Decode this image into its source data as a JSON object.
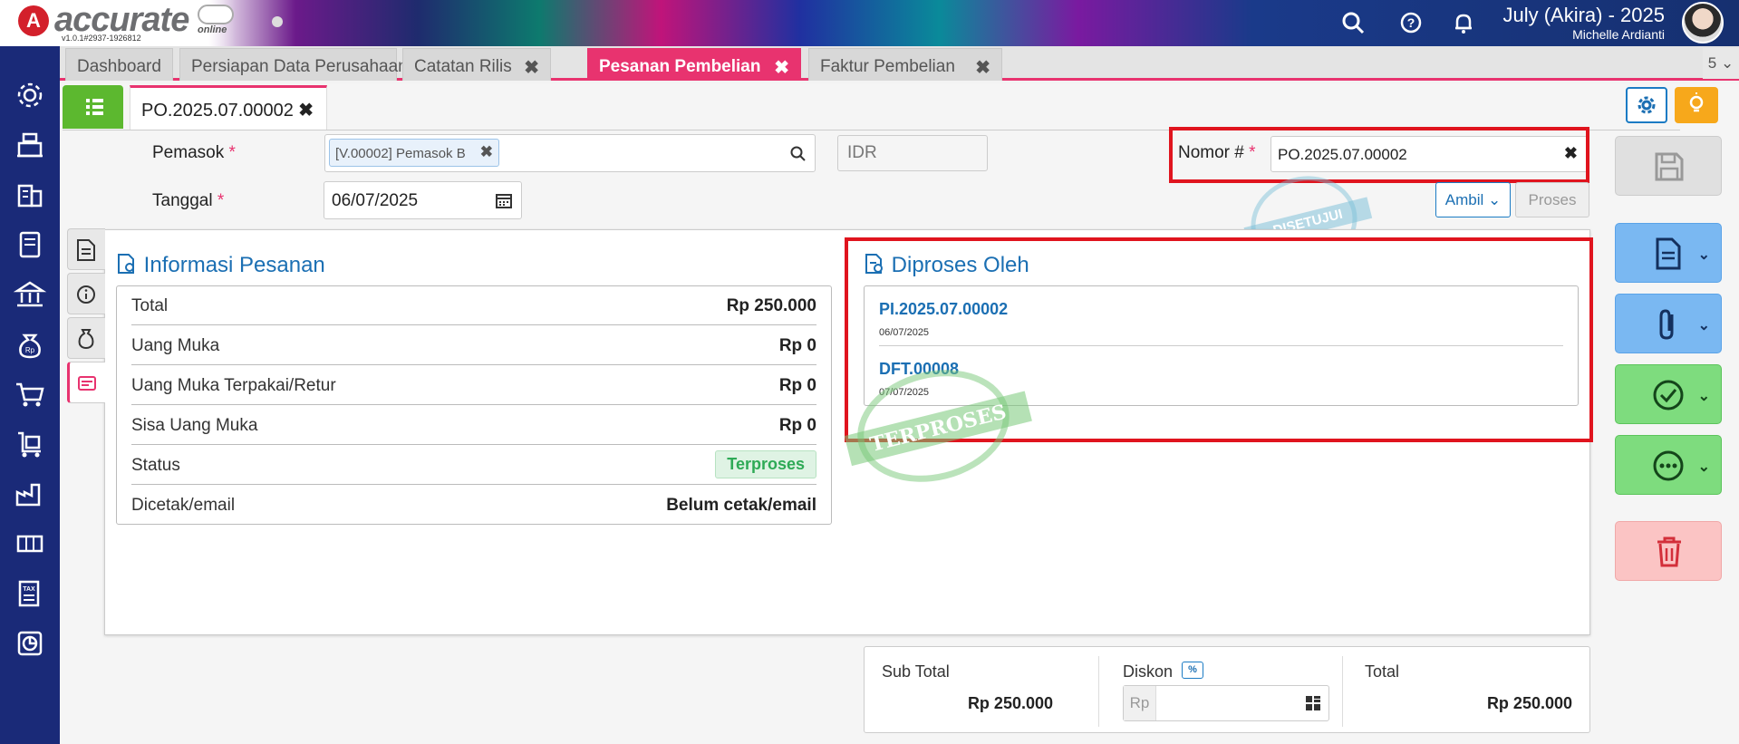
{
  "app": {
    "brand": "accurate",
    "brand_sub": "online",
    "version": "v1.0.1#2937-1926812",
    "period": "July (Akira) - 2025",
    "user_name": "Michelle Ardianti"
  },
  "topbar_icons": [
    "search-icon",
    "help-icon",
    "bell-icon"
  ],
  "sidebar": {
    "items": [
      {
        "icon": "settings-icon"
      },
      {
        "icon": "cash-register-icon"
      },
      {
        "icon": "building-icon"
      },
      {
        "icon": "ledger-book-icon"
      },
      {
        "icon": "bank-icon"
      },
      {
        "icon": "money-bag-icon"
      },
      {
        "icon": "shopping-cart-icon"
      },
      {
        "icon": "delivery-cart-icon"
      },
      {
        "icon": "factory-icon"
      },
      {
        "icon": "production-line-icon"
      },
      {
        "icon": "tax-document-icon"
      },
      {
        "icon": "report-chart-icon"
      }
    ]
  },
  "tabs": [
    {
      "label": "Dashboard",
      "closable": false,
      "active": false
    },
    {
      "label": "Persiapan Data Perusahaan",
      "closable": false,
      "active": false
    },
    {
      "label": "Catatan Rilis",
      "closable": true,
      "active": false
    },
    {
      "label": "Pesanan Pembelian",
      "closable": true,
      "active": true
    },
    {
      "label": "Faktur Pembelian",
      "closable": true,
      "active": false
    }
  ],
  "tab_overflow": "5",
  "close_glyph": "✖",
  "document_tab": {
    "label": "PO.2025.07.00002"
  },
  "form": {
    "supplier_label": "Pemasok",
    "supplier_value": "[V.00002] Pemasok B",
    "currency": "IDR",
    "date_label": "Tanggal",
    "date_value": "06/07/2025",
    "number_label": "Nomor #",
    "number_value": "PO.2025.07.00002",
    "required_mark": "*",
    "ambil_label": "Ambil",
    "proses_label": "Proses"
  },
  "stamps": {
    "approved": "DISETUJUI",
    "processed": "TERPROSES"
  },
  "info_section": {
    "title": "Informasi Pesanan",
    "rows": [
      {
        "label": "Total",
        "value": "Rp 250.000"
      },
      {
        "label": "Uang Muka",
        "value": "Rp 0"
      },
      {
        "label": "Uang Muka Terpakai/Retur",
        "value": "Rp 0"
      },
      {
        "label": "Sisa Uang Muka",
        "value": "Rp 0"
      },
      {
        "label": "Status",
        "value": "Terproses"
      },
      {
        "label": "Dicetak/email",
        "value": "Belum cetak/email"
      }
    ]
  },
  "processed_section": {
    "title": "Diproses Oleh",
    "items": [
      {
        "number": "PI.2025.07.00002",
        "date": "06/07/2025"
      },
      {
        "number": "DFT.00008",
        "date": "07/07/2025"
      }
    ]
  },
  "totals": {
    "subtotal_label": "Sub Total",
    "subtotal_value": "Rp 250.000",
    "discount_label": "Diskon",
    "discount_pct": "%",
    "discount_prefix": "Rp",
    "total_label": "Total",
    "total_value": "Rp 250.000"
  },
  "colors": {
    "accent": "#e8336f",
    "sidebar": "#1a2a78",
    "link": "#1b6fb3",
    "highlight_border": "#e0141e",
    "success": "#2eaa56"
  }
}
